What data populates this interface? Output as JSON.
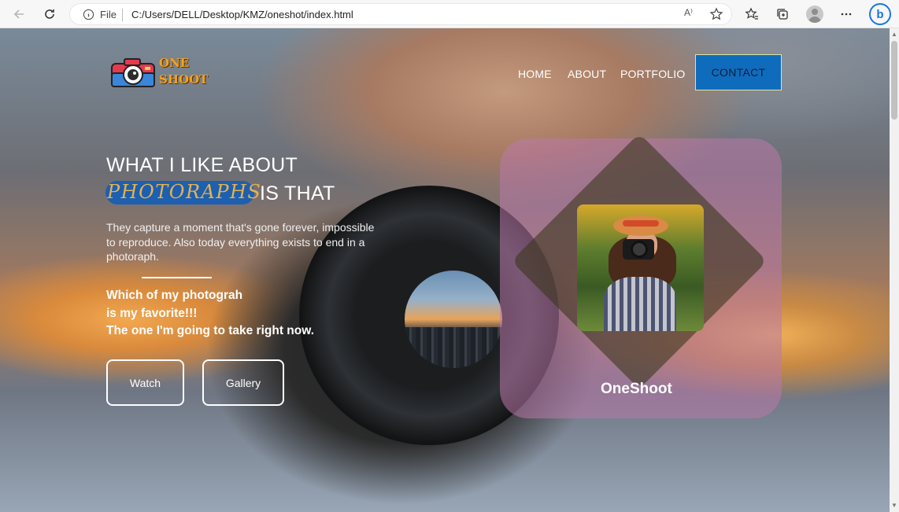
{
  "browser": {
    "file_label": "File",
    "url": "C:/Users/DELL/Desktop/KMZ/oneshot/index.html",
    "read_aloud_label": "A⁾"
  },
  "site": {
    "logo": {
      "line1": "ONE",
      "line2": "SHOOT"
    },
    "nav": {
      "home": "HOME",
      "about": "ABOUT",
      "portfolio": "PORTFOLIO",
      "contact": "CONTACT"
    },
    "hero": {
      "line1": "WHAT I LIKE ABOUT",
      "accent": "PHOTORAPHS",
      "rest": "IS THAT",
      "description": "They capture a moment that's gone forever, impossible to reproduce. Also today everything exists to end in a photoraph.",
      "quote1": "Which of my photograh",
      "quote2": "is my favorite!!!",
      "quote3": "The one I'm going to take right now.",
      "watch_label": "Watch",
      "gallery_label": "Gallery"
    },
    "card": {
      "title": "OneShoot"
    }
  },
  "colors": {
    "accent_blue": "#0f6cbd",
    "highlight_blue": "#1d5fb0",
    "accent_gold": "#e6b24a",
    "card_tint": "#b978aa"
  },
  "icons": [
    "back-arrow-icon",
    "reload-icon",
    "info-icon",
    "read-aloud-icon",
    "add-favorite-icon",
    "favorites-icon",
    "collections-icon",
    "profile-icon",
    "more-icon",
    "bing-icon",
    "camera-logo-icon"
  ]
}
